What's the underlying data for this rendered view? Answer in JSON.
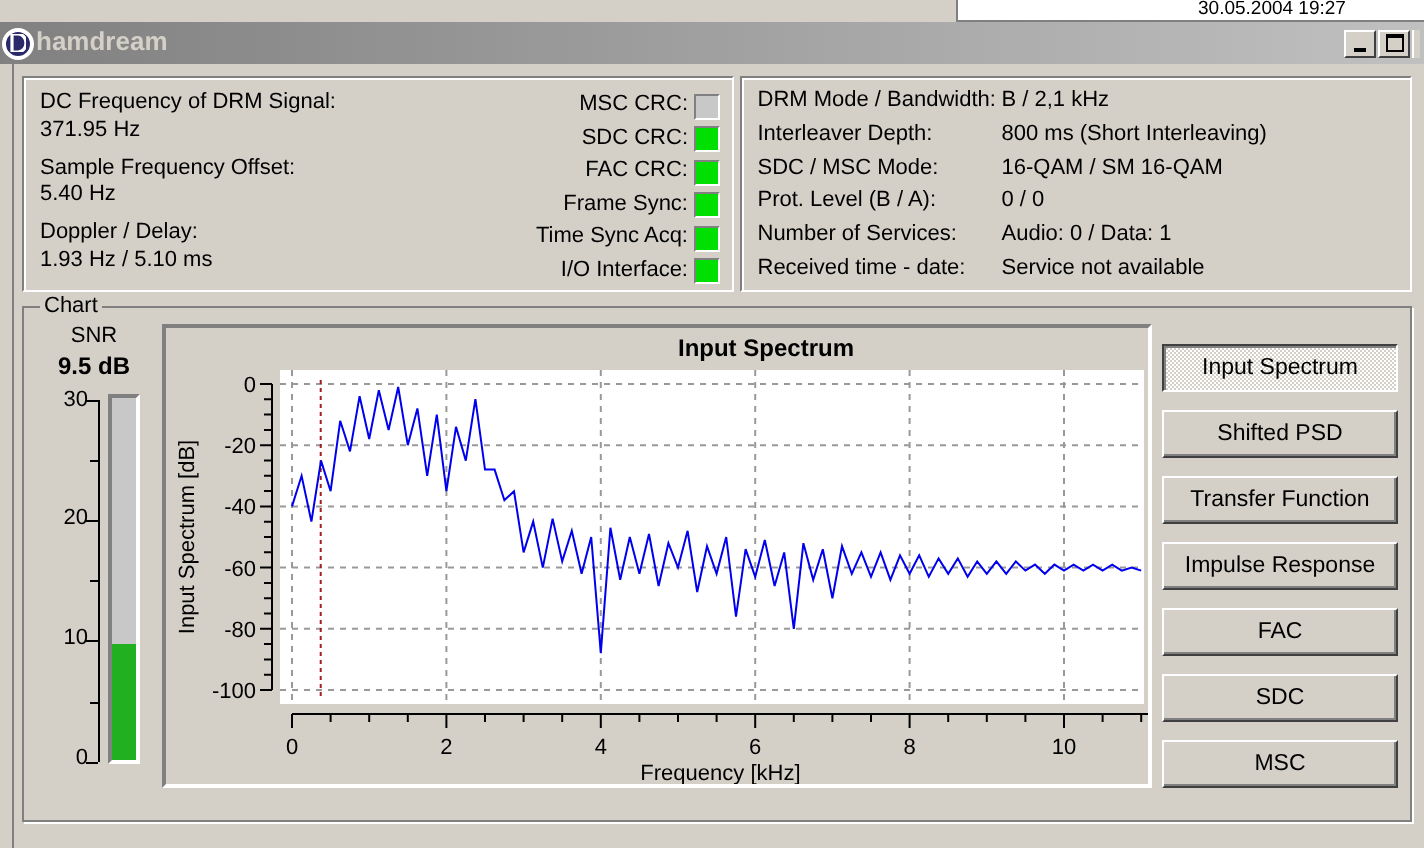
{
  "background": {
    "date_field": "30.05.2004 19:27"
  },
  "window": {
    "title": "hamdream"
  },
  "signal_info": [
    {
      "label": "DC Frequency of DRM Signal:",
      "value": "371.95 Hz"
    },
    {
      "label": "Sample Frequency Offset:",
      "value": "5.40 Hz"
    },
    {
      "label": "Doppler / Delay:",
      "value": "1.93 Hz / 5.10 ms"
    }
  ],
  "indicators": [
    {
      "label": "MSC CRC:",
      "on": false
    },
    {
      "label": "SDC CRC:",
      "on": true
    },
    {
      "label": "FAC CRC:",
      "on": true
    },
    {
      "label": "Frame Sync:",
      "on": true
    },
    {
      "label": "Time Sync Acq:",
      "on": true
    },
    {
      "label": "I/O Interface:",
      "on": true
    }
  ],
  "drm_info": [
    {
      "label": "DRM Mode / Bandwidth:",
      "value": "B / 2,1 kHz"
    },
    {
      "label": "Interleaver Depth:",
      "value": "800 ms (Short Interleaving)"
    },
    {
      "label": "SDC / MSC Mode:",
      "value": "16-QAM / SM 16-QAM"
    },
    {
      "label": "Prot. Level (B / A):",
      "value": "0 / 0"
    },
    {
      "label": "Number of Services:",
      "value": "Audio: 0 / Data: 1"
    },
    {
      "label": "Received time - date:",
      "value": "Service not available"
    }
  ],
  "chart_group": {
    "title": "Chart",
    "snr": {
      "label": "SNR",
      "value": "9.5 dB",
      "level": 0.317,
      "scale": [
        "30",
        "20",
        "10",
        "0"
      ]
    },
    "chart_data": {
      "type": "line",
      "title": "Input Spectrum",
      "xlabel": "Frequency [kHz]",
      "ylabel": "Input Spectrum [dB]",
      "x": [
        0,
        0.125,
        0.25,
        0.375,
        0.5,
        0.625,
        0.75,
        0.875,
        1,
        1.125,
        1.25,
        1.375,
        1.5,
        1.625,
        1.75,
        1.875,
        2,
        2.125,
        2.25,
        2.375,
        2.5,
        2.625,
        2.75,
        2.875,
        3,
        3.125,
        3.25,
        3.375,
        3.5,
        3.625,
        3.75,
        3.875,
        4,
        4.125,
        4.25,
        4.375,
        4.5,
        4.625,
        4.75,
        4.875,
        5,
        5.125,
        5.25,
        5.375,
        5.5,
        5.625,
        5.75,
        5.875,
        6,
        6.125,
        6.25,
        6.375,
        6.5,
        6.625,
        6.75,
        6.875,
        7,
        7.125,
        7.25,
        7.375,
        7.5,
        7.625,
        7.75,
        7.875,
        8,
        8.125,
        8.25,
        8.375,
        8.5,
        8.625,
        8.75,
        8.875,
        9,
        9.125,
        9.25,
        9.375,
        9.5,
        9.625,
        9.75,
        9.875,
        10,
        10.125,
        10.25,
        10.375,
        10.5,
        10.625,
        10.75,
        10.875,
        11
      ],
      "series": [
        {
          "color": "#0000ee",
          "values": [
            -40,
            -30,
            -45,
            -25,
            -35,
            -12,
            -22,
            -4,
            -18,
            -2,
            -15,
            -1,
            -20,
            -8,
            -30,
            -10,
            -35,
            -14,
            -25,
            -5,
            -28,
            -28,
            -38,
            -35,
            -55,
            -45,
            -60,
            -44,
            -58,
            -48,
            -62,
            -50,
            -88,
            -47,
            -64,
            -50,
            -62,
            -49,
            -66,
            -52,
            -60,
            -48,
            -68,
            -53,
            -62,
            -50,
            -76,
            -54,
            -63,
            -51,
            -66,
            -55,
            -80,
            -52,
            -64,
            -54,
            -70,
            -53,
            -62,
            -55,
            -63,
            -55,
            -64,
            -56,
            -62,
            -56,
            -63,
            -57,
            -62,
            -57,
            -63,
            -58,
            -62,
            -58,
            -62,
            -58,
            -61,
            -59,
            -62,
            -59,
            -61,
            -59,
            -61,
            -59,
            -61,
            -59,
            -61,
            -60,
            -61
          ]
        }
      ],
      "xlim": [
        0,
        11.1
      ],
      "ylim": [
        -100,
        0
      ],
      "xticks": [
        0,
        2,
        4,
        6,
        8,
        10
      ],
      "yticks": [
        0,
        -20,
        -40,
        -60,
        -80,
        -100
      ],
      "grid": true,
      "ref_lines": [
        {
          "axis": "x",
          "value": 0.372,
          "color": "#a02020"
        }
      ]
    },
    "buttons": [
      {
        "label": "Input Spectrum",
        "selected": true
      },
      {
        "label": "Shifted PSD",
        "selected": false
      },
      {
        "label": "Transfer Function",
        "selected": false
      },
      {
        "label": "Impulse Response",
        "selected": false
      },
      {
        "label": "FAC",
        "selected": false
      },
      {
        "label": "SDC",
        "selected": false
      },
      {
        "label": "MSC",
        "selected": false
      }
    ]
  }
}
